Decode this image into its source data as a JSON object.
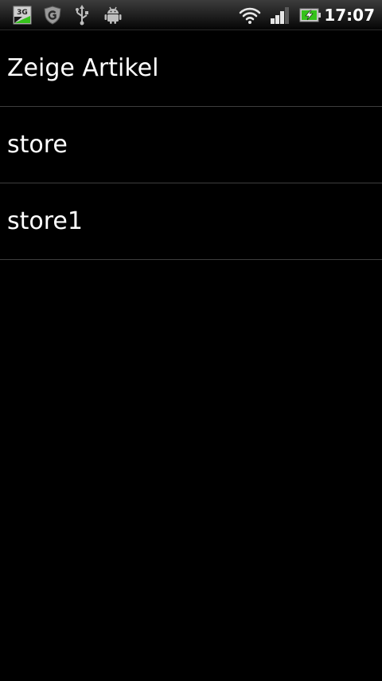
{
  "status_bar": {
    "network_badge": "3G",
    "time": "17:07",
    "left_icons": [
      "3g-data-icon",
      "guard-shield-icon",
      "usb-icon",
      "android-debug-icon"
    ],
    "right_icons": [
      "wifi-icon",
      "signal-strength-icon",
      "battery-charging-icon"
    ],
    "colors": {
      "accent_green": "#35c21b",
      "icon_gray": "#bdbdbd"
    }
  },
  "list": {
    "items": [
      {
        "label": "Zeige Artikel"
      },
      {
        "label": "store"
      },
      {
        "label": "store1"
      }
    ]
  }
}
